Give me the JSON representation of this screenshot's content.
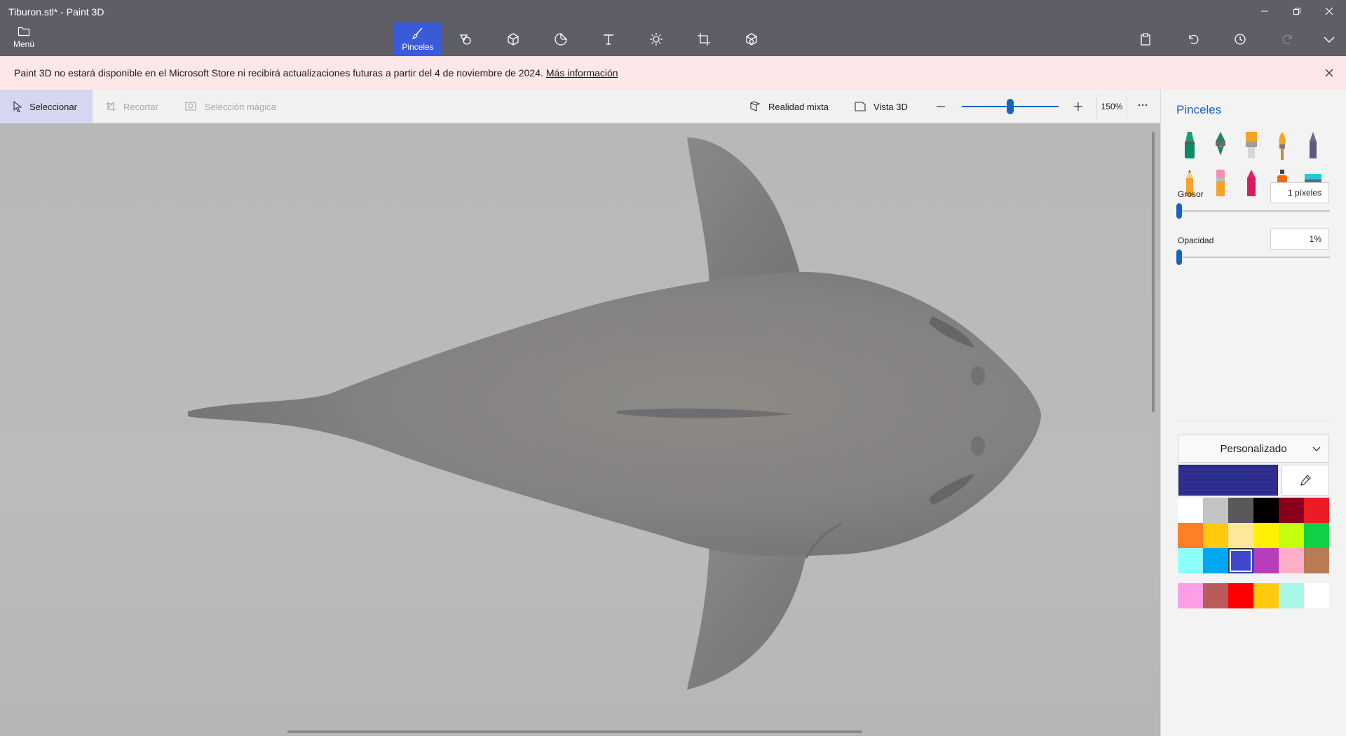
{
  "window": {
    "title": "Tiburon.stl* - Paint 3D"
  },
  "menu": {
    "label": "Menú"
  },
  "toolbar": {
    "active_tab_label": "Pinceles",
    "tabs": [
      "brushes",
      "2d-shapes",
      "3d-shapes",
      "stickers",
      "text",
      "effects",
      "canvas",
      "3d-library"
    ]
  },
  "notice": {
    "text": "Paint 3D no estará disponible en el Microsoft Store ni recibirá actualizaciones futuras a partir del 4 de noviembre de 2024.",
    "link": "Más información"
  },
  "subbar": {
    "select": "Seleccionar",
    "crop": "Recortar",
    "magic_select": "Selección mágica",
    "mixed_reality": "Realidad mixta",
    "view_3d": "Vista 3D",
    "zoom": "150%",
    "zoom_level": 0.5
  },
  "panel": {
    "title": "Pinceles",
    "brushes": [
      "marker",
      "calligraphy-pen",
      "oil-brush",
      "watercolor",
      "pixel-pen",
      "pencil",
      "eraser",
      "crayon",
      "spray-can",
      "fill"
    ],
    "thickness_label": "Grosor",
    "thickness_value": "1 píxeles",
    "thickness_level": 0,
    "opacity_label": "Opacidad",
    "opacity_value": "1%",
    "opacity_level": 0,
    "color_mode": "Personalizado",
    "current_color": "#2d2e8e",
    "palette": [
      "#ffffff",
      "#c3c3c3",
      "#585858",
      "#000000",
      "#88001b",
      "#ec1c24",
      "#ff7f27",
      "#ffc90e",
      "#fde79a",
      "#fff200",
      "#c4ff0e",
      "#0ed145",
      "#8cfffb",
      "#00a8f3",
      "#3f48cc",
      "#b83dba",
      "#ffaec8",
      "#b97a56"
    ],
    "selected_palette_index": 14,
    "custom_palette": [
      "#ff9ee6",
      "#bb5a5a",
      "#ff0000",
      "#ffc90e",
      "#a8f8e8",
      "#ffffff"
    ]
  }
}
